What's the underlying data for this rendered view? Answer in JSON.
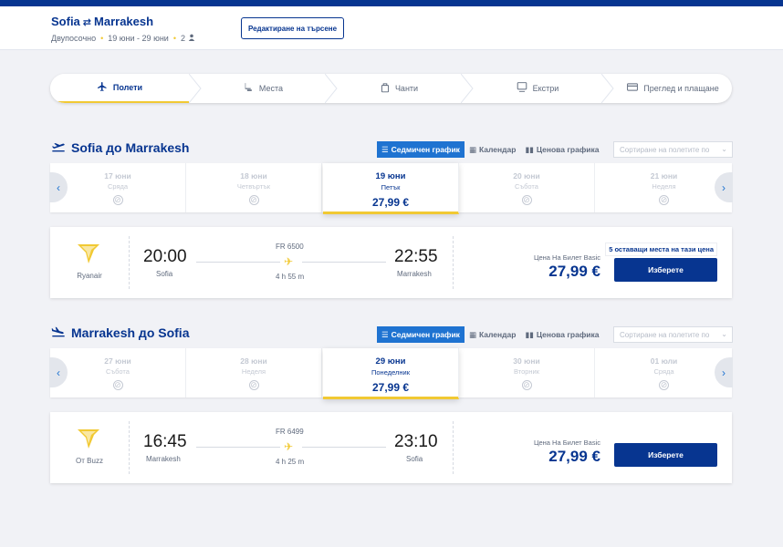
{
  "header": {
    "origin": "Sofia",
    "route_icon": "round-trip-arrows-icon",
    "destination": "Marrakesh",
    "trip_type": "Двупосочно",
    "dates": "19 юни - 29 юни",
    "passengers": "2",
    "edit_label": "Редактиране на търсене"
  },
  "steps": [
    {
      "label": "Полети",
      "icon": "plane-icon"
    },
    {
      "label": "Места",
      "icon": "seat-icon"
    },
    {
      "label": "Чанти",
      "icon": "bag-icon"
    },
    {
      "label": "Екстри",
      "icon": "extras-icon"
    },
    {
      "label": "Преглед и плащане",
      "icon": "card-icon"
    }
  ],
  "view_tabs": {
    "weekly": "Седмичен график",
    "calendar": "Календар",
    "price_chart": "Ценова графика"
  },
  "sort_placeholder": "Сортиране на полетите по",
  "outbound": {
    "title": "Sofia до Marrakesh",
    "dates": [
      {
        "day": "17 юни",
        "weekday": "Сряда",
        "price": ""
      },
      {
        "day": "18 юни",
        "weekday": "Четвъртък",
        "price": ""
      },
      {
        "day": "19 юни",
        "weekday": "Петък",
        "price": "27,99 €"
      },
      {
        "day": "20 юни",
        "weekday": "Събота",
        "price": ""
      },
      {
        "day": "21 юни",
        "weekday": "Неделя",
        "price": ""
      }
    ],
    "flight": {
      "airline": "Ryanair",
      "depart_time": "20:00",
      "depart_city": "Sofia",
      "flight_number": "FR 6500",
      "duration": "4 h 55 m",
      "arrive_time": "22:55",
      "arrive_city": "Marrakesh",
      "price_type": "Цена На Билет Basic",
      "price": "27,99 €",
      "seats_left": "5 оставащи места на тази цена",
      "select_label": "Изберете"
    }
  },
  "inbound": {
    "title": "Marrakesh до Sofia",
    "dates": [
      {
        "day": "27 юни",
        "weekday": "Събота",
        "price": ""
      },
      {
        "day": "28 юни",
        "weekday": "Неделя",
        "price": ""
      },
      {
        "day": "29 юни",
        "weekday": "Понеделник",
        "price": "27,99 €"
      },
      {
        "day": "30 юни",
        "weekday": "Вторник",
        "price": ""
      },
      {
        "day": "01 юли",
        "weekday": "Сряда",
        "price": ""
      }
    ],
    "flight": {
      "airline": "От Buzz",
      "depart_time": "16:45",
      "depart_city": "Marrakesh",
      "flight_number": "FR 6499",
      "duration": "4 h 25 m",
      "arrive_time": "23:10",
      "arrive_city": "Sofia",
      "price_type": "Цена На Билет Basic",
      "price": "27,99 €",
      "select_label": "Изберете"
    }
  },
  "colors": {
    "brand": "#073590",
    "accent": "#f1c933",
    "tab_active": "#1f73d1"
  }
}
